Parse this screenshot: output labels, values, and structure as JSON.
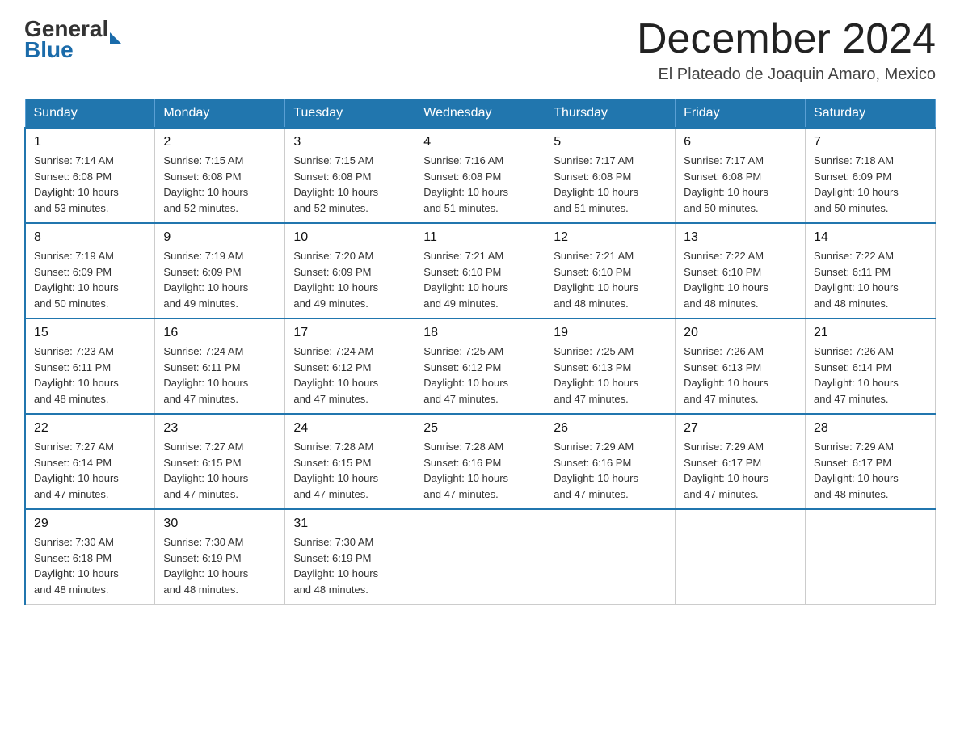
{
  "header": {
    "logo_general": "General",
    "logo_blue": "Blue",
    "title": "December 2024",
    "location": "El Plateado de Joaquin Amaro, Mexico"
  },
  "days_of_week": [
    "Sunday",
    "Monday",
    "Tuesday",
    "Wednesday",
    "Thursday",
    "Friday",
    "Saturday"
  ],
  "weeks": [
    [
      {
        "day": "1",
        "sunrise": "7:14 AM",
        "sunset": "6:08 PM",
        "daylight": "10 hours and 53 minutes."
      },
      {
        "day": "2",
        "sunrise": "7:15 AM",
        "sunset": "6:08 PM",
        "daylight": "10 hours and 52 minutes."
      },
      {
        "day": "3",
        "sunrise": "7:15 AM",
        "sunset": "6:08 PM",
        "daylight": "10 hours and 52 minutes."
      },
      {
        "day": "4",
        "sunrise": "7:16 AM",
        "sunset": "6:08 PM",
        "daylight": "10 hours and 51 minutes."
      },
      {
        "day": "5",
        "sunrise": "7:17 AM",
        "sunset": "6:08 PM",
        "daylight": "10 hours and 51 minutes."
      },
      {
        "day": "6",
        "sunrise": "7:17 AM",
        "sunset": "6:08 PM",
        "daylight": "10 hours and 50 minutes."
      },
      {
        "day": "7",
        "sunrise": "7:18 AM",
        "sunset": "6:09 PM",
        "daylight": "10 hours and 50 minutes."
      }
    ],
    [
      {
        "day": "8",
        "sunrise": "7:19 AM",
        "sunset": "6:09 PM",
        "daylight": "10 hours and 50 minutes."
      },
      {
        "day": "9",
        "sunrise": "7:19 AM",
        "sunset": "6:09 PM",
        "daylight": "10 hours and 49 minutes."
      },
      {
        "day": "10",
        "sunrise": "7:20 AM",
        "sunset": "6:09 PM",
        "daylight": "10 hours and 49 minutes."
      },
      {
        "day": "11",
        "sunrise": "7:21 AM",
        "sunset": "6:10 PM",
        "daylight": "10 hours and 49 minutes."
      },
      {
        "day": "12",
        "sunrise": "7:21 AM",
        "sunset": "6:10 PM",
        "daylight": "10 hours and 48 minutes."
      },
      {
        "day": "13",
        "sunrise": "7:22 AM",
        "sunset": "6:10 PM",
        "daylight": "10 hours and 48 minutes."
      },
      {
        "day": "14",
        "sunrise": "7:22 AM",
        "sunset": "6:11 PM",
        "daylight": "10 hours and 48 minutes."
      }
    ],
    [
      {
        "day": "15",
        "sunrise": "7:23 AM",
        "sunset": "6:11 PM",
        "daylight": "10 hours and 48 minutes."
      },
      {
        "day": "16",
        "sunrise": "7:24 AM",
        "sunset": "6:11 PM",
        "daylight": "10 hours and 47 minutes."
      },
      {
        "day": "17",
        "sunrise": "7:24 AM",
        "sunset": "6:12 PM",
        "daylight": "10 hours and 47 minutes."
      },
      {
        "day": "18",
        "sunrise": "7:25 AM",
        "sunset": "6:12 PM",
        "daylight": "10 hours and 47 minutes."
      },
      {
        "day": "19",
        "sunrise": "7:25 AM",
        "sunset": "6:13 PM",
        "daylight": "10 hours and 47 minutes."
      },
      {
        "day": "20",
        "sunrise": "7:26 AM",
        "sunset": "6:13 PM",
        "daylight": "10 hours and 47 minutes."
      },
      {
        "day": "21",
        "sunrise": "7:26 AM",
        "sunset": "6:14 PM",
        "daylight": "10 hours and 47 minutes."
      }
    ],
    [
      {
        "day": "22",
        "sunrise": "7:27 AM",
        "sunset": "6:14 PM",
        "daylight": "10 hours and 47 minutes."
      },
      {
        "day": "23",
        "sunrise": "7:27 AM",
        "sunset": "6:15 PM",
        "daylight": "10 hours and 47 minutes."
      },
      {
        "day": "24",
        "sunrise": "7:28 AM",
        "sunset": "6:15 PM",
        "daylight": "10 hours and 47 minutes."
      },
      {
        "day": "25",
        "sunrise": "7:28 AM",
        "sunset": "6:16 PM",
        "daylight": "10 hours and 47 minutes."
      },
      {
        "day": "26",
        "sunrise": "7:29 AM",
        "sunset": "6:16 PM",
        "daylight": "10 hours and 47 minutes."
      },
      {
        "day": "27",
        "sunrise": "7:29 AM",
        "sunset": "6:17 PM",
        "daylight": "10 hours and 47 minutes."
      },
      {
        "day": "28",
        "sunrise": "7:29 AM",
        "sunset": "6:17 PM",
        "daylight": "10 hours and 48 minutes."
      }
    ],
    [
      {
        "day": "29",
        "sunrise": "7:30 AM",
        "sunset": "6:18 PM",
        "daylight": "10 hours and 48 minutes."
      },
      {
        "day": "30",
        "sunrise": "7:30 AM",
        "sunset": "6:19 PM",
        "daylight": "10 hours and 48 minutes."
      },
      {
        "day": "31",
        "sunrise": "7:30 AM",
        "sunset": "6:19 PM",
        "daylight": "10 hours and 48 minutes."
      },
      null,
      null,
      null,
      null
    ]
  ],
  "labels": {
    "sunrise": "Sunrise:",
    "sunset": "Sunset:",
    "daylight": "Daylight:"
  }
}
